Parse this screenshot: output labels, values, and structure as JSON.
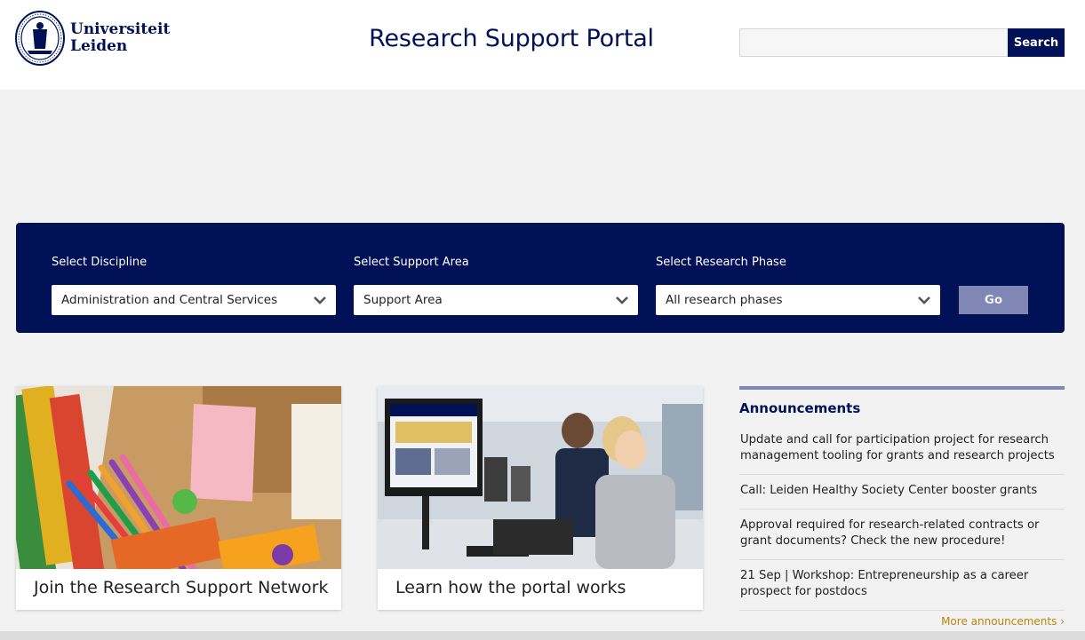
{
  "header": {
    "logo_line1": "Universiteit",
    "logo_line2": "Leiden",
    "title": "Research Support Portal",
    "search_placeholder": "",
    "search_button": "Search"
  },
  "filters": {
    "discipline_label": "Select Discipline",
    "discipline_value": "Administration and Central Services",
    "area_label": "Select Support Area",
    "area_value": "Support Area",
    "phase_label": "Select Research Phase",
    "phase_value": "All research phases",
    "go_button": "Go"
  },
  "cards": [
    {
      "title": "Join the Research Support Network",
      "image": "colorful-stickers-and-markers-photo"
    },
    {
      "title": "Learn how the portal works",
      "image": "students-at-computers-photo"
    }
  ],
  "announcements": {
    "heading": "Announcements",
    "items": [
      "Update and call for participation project for research management tooling for grants and research projects",
      "Call: Leiden Healthy Society Center booster grants",
      "Approval required for research-related contracts or grant documents? Check the new procedure!",
      "21 Sep | Workshop: Entrepreneurship as a career prospect for postdocs"
    ],
    "more_link": "More announcements ›"
  },
  "colors": {
    "brand_navy": "#001158",
    "go_button": "#8087b4",
    "accent_gold": "#b8860b",
    "page_bg": "#f2f2f2"
  }
}
